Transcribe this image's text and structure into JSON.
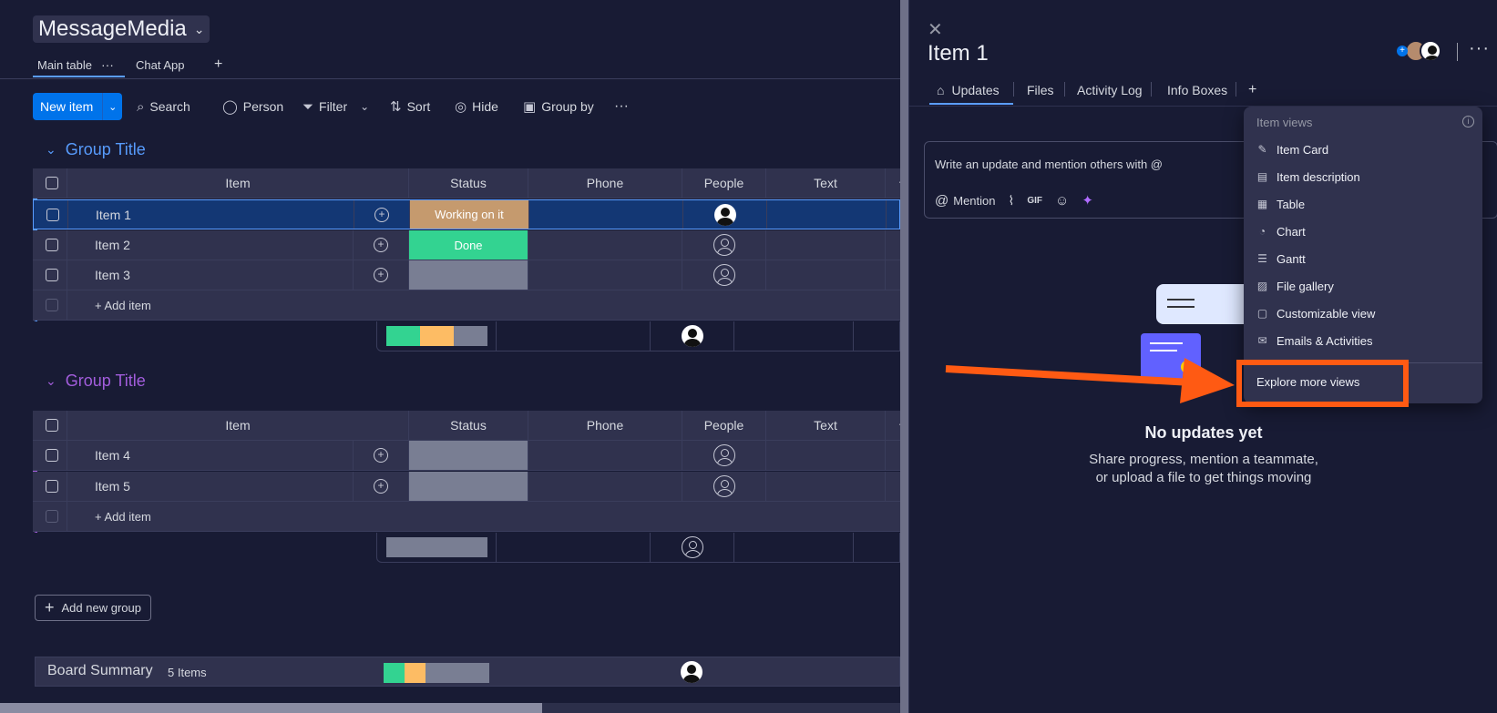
{
  "board": {
    "title": "MessageMedia",
    "view_tabs": [
      "Main table",
      "Chat App"
    ],
    "add_view": "+",
    "toolbar": {
      "new_item": "New item",
      "search": "Search",
      "person": "Person",
      "filter": "Filter",
      "sort": "Sort",
      "hide": "Hide",
      "group_by": "Group by",
      "more": "···"
    },
    "columns": {
      "item": "Item",
      "status": "Status",
      "phone": "Phone",
      "people": "People",
      "text": "Text",
      "add": "+"
    },
    "groups": [
      {
        "title": "Group Title",
        "color": "#579bfc",
        "rows": [
          {
            "name": "Item 1",
            "status": "Working on it",
            "status_color": "#c59a6e",
            "person": "filled"
          },
          {
            "name": "Item 2",
            "status": "Done",
            "status_color": "#33d391",
            "person": "empty"
          },
          {
            "name": "Item 3",
            "status": "",
            "status_color": "#797e93",
            "person": "empty"
          }
        ],
        "add_item": "+ Add item"
      },
      {
        "title": "Group Title",
        "color": "#a25ddc",
        "rows": [
          {
            "name": "Item 4",
            "status": "",
            "status_color": "#797e93",
            "person": "empty"
          },
          {
            "name": "Item 5",
            "status": "",
            "status_color": "#797e93",
            "person": "empty"
          }
        ],
        "add_item": "+ Add item"
      }
    ],
    "add_group": "Add new group",
    "summary": {
      "title": "Board Summary",
      "count": "5 Items"
    }
  },
  "panel": {
    "close": "✕",
    "item_title": "Item 1",
    "tabs": [
      "Updates",
      "Files",
      "Activity Log",
      "Info Boxes",
      "+"
    ],
    "editor_placeholder": "Write an update and mention others with @",
    "editor_tools": {
      "mention": "Mention",
      "gif": "GIF"
    },
    "empty_title": "No updates yet",
    "empty_line1": "Share progress, mention a teammate,",
    "empty_line2": "or upload a file to get things moving",
    "more": "···"
  },
  "menu": {
    "header": "Item views",
    "items": [
      {
        "label": "Item Card",
        "icon": "item-card-icon"
      },
      {
        "label": "Item description",
        "icon": "document-icon"
      },
      {
        "label": "Table",
        "icon": "table-icon"
      },
      {
        "label": "Chart",
        "icon": "chart-icon"
      },
      {
        "label": "Gantt",
        "icon": "gantt-icon"
      },
      {
        "label": "File gallery",
        "icon": "gallery-icon"
      },
      {
        "label": "Customizable view",
        "icon": "square-icon"
      },
      {
        "label": "Emails & Activities",
        "icon": "mail-icon"
      }
    ],
    "explore": "Explore more views"
  },
  "colors": {
    "accent": "#0073ea",
    "highlight": "#ff5a13",
    "done": "#33d391",
    "working": "#fdab3d",
    "default": "#797e93"
  }
}
